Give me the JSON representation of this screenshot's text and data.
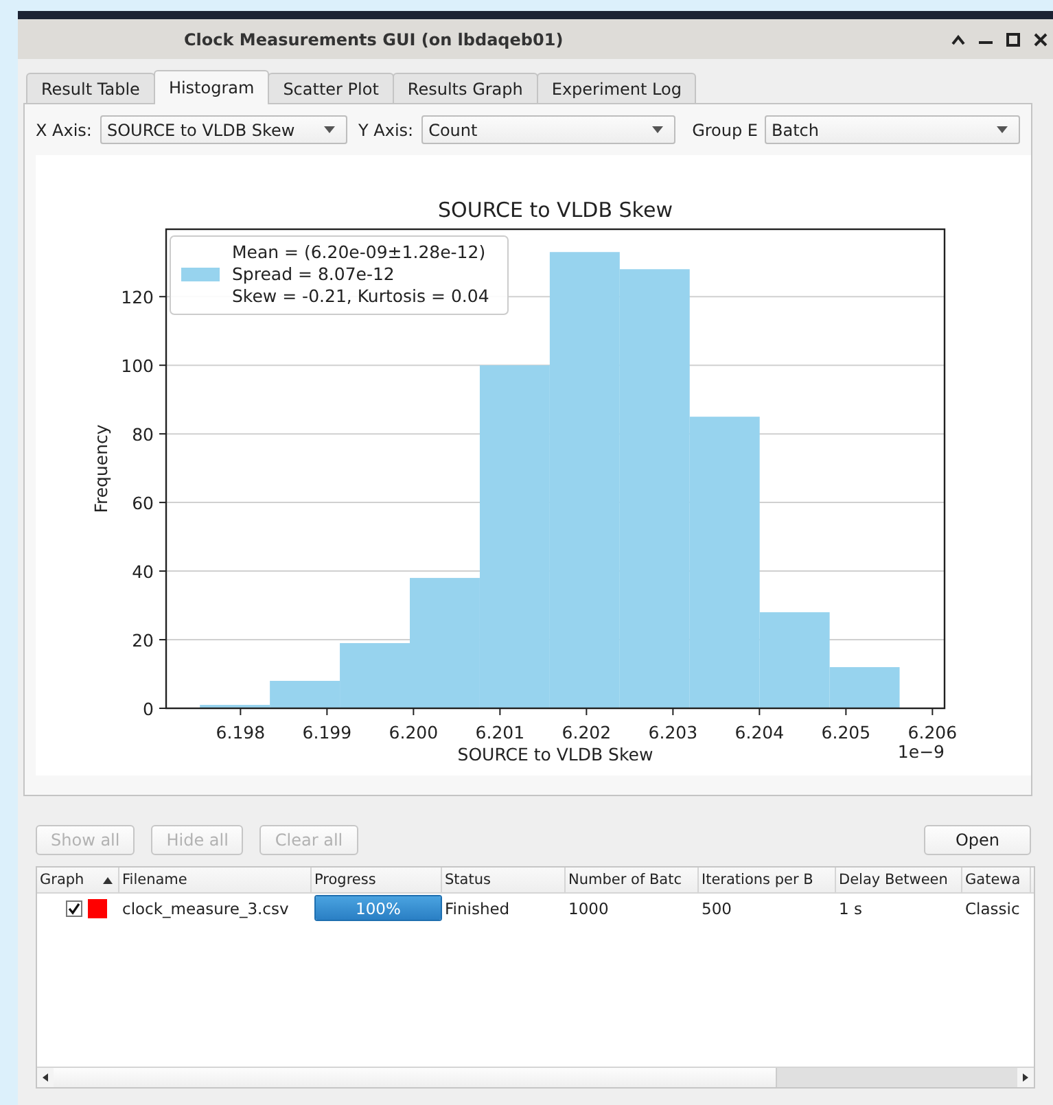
{
  "window": {
    "title": "Clock Measurements GUI (on lbdaqeb01)"
  },
  "tabs": [
    {
      "label": "Result Table",
      "selected": false
    },
    {
      "label": "Histogram",
      "selected": true
    },
    {
      "label": "Scatter Plot",
      "selected": false
    },
    {
      "label": "Results Graph",
      "selected": false
    },
    {
      "label": "Experiment Log",
      "selected": false
    }
  ],
  "selectors": [
    {
      "label": "X Axis:",
      "value": "SOURCE to VLDB Skew"
    },
    {
      "label": "Y Axis:",
      "value": "Count"
    },
    {
      "label": "Group E",
      "value": "Batch"
    }
  ],
  "chart": {
    "legend": [
      "Mean = (6.20e-09±1.28e-12)",
      "Spread = 8.07e-12",
      "Skew = -0.21, Kurtosis = 0.04"
    ],
    "offset_label": "1e−9",
    "chart_data": {
      "type": "bar",
      "title": "SOURCE to VLDB Skew",
      "xlabel": "SOURCE to VLDB Skew",
      "ylabel": "Frequency",
      "x": [
        6.197935,
        6.198744,
        6.199553,
        6.200362,
        6.201171,
        6.20198,
        6.202789,
        6.203598,
        6.204407,
        6.205216
      ],
      "series": [
        {
          "color": "#97d3ee",
          "values": [
            1,
            8,
            19,
            38,
            100,
            133,
            128,
            85,
            28,
            12
          ]
        }
      ],
      "xlim": [
        6.19714,
        6.20614
      ],
      "ylim": [
        0,
        139.65
      ],
      "xticks": [
        {
          "value": 6.198,
          "label": "6.198"
        },
        {
          "value": 6.199,
          "label": "6.199"
        },
        {
          "value": 6.2,
          "label": "6.200"
        },
        {
          "value": 6.201,
          "label": "6.201"
        },
        {
          "value": 6.202,
          "label": "6.202"
        },
        {
          "value": 6.203,
          "label": "6.203"
        },
        {
          "value": 6.204,
          "label": "6.204"
        },
        {
          "value": 6.205,
          "label": "6.205"
        },
        {
          "value": 6.206,
          "label": "6.206"
        }
      ],
      "yticks": [
        0,
        20,
        40,
        60,
        80,
        100,
        120
      ],
      "grid": true
    }
  },
  "buttons": [
    {
      "label": "Show all",
      "disabled": true
    },
    {
      "label": "Hide all",
      "disabled": true
    },
    {
      "label": "Clear all",
      "disabled": true
    }
  ],
  "open_button": {
    "label": "Open"
  },
  "table": {
    "columns": [
      "Graph",
      "Filename",
      "Progress",
      "Status",
      "Number of Batc",
      "Iterations per B",
      "Delay Between",
      "Gatewa"
    ],
    "rows": [
      {
        "checked": true,
        "color": "#ff0000",
        "filename": "clock_measure_3.csv",
        "level": 1,
        "progress": "100%",
        "status": "Finished",
        "batches": "1000",
        "iterations": "500",
        "delay": "1 s",
        "gateway": "Classic"
      }
    ]
  }
}
